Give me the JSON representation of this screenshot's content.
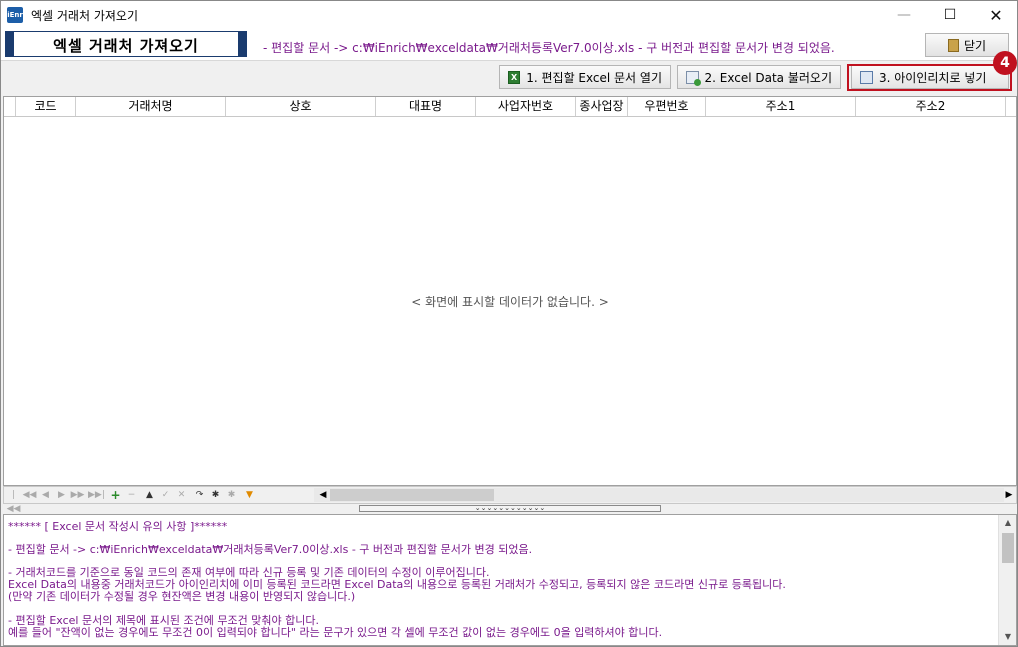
{
  "window": {
    "title": "엑셀 거래처 가져오기",
    "icon_text": "iEnr",
    "min_glyph": "—",
    "max_glyph": "☐",
    "close_glyph": "✕"
  },
  "header": {
    "main_title": "엑셀 거래처 가져오기",
    "path_note": "- 편집할 문서 -> c:₩iEnrich₩exceldata₩거래처등록Ver7.0이상.xls - 구 버전과 편집할 문서가 변경 되었음.",
    "close_label": "닫기"
  },
  "toolbar": {
    "open_excel_label": "1. 편집할 Excel 문서 열기",
    "load_data_label": "2. Excel Data 불러오기",
    "insert_label": "3. 아이인리치로 넣기",
    "step_badge": "4"
  },
  "grid": {
    "columns": [
      "코드",
      "거래처명",
      "상호",
      "대표명",
      "사업자번호",
      "종사업장",
      "우편번호",
      "주소1",
      "주소2"
    ],
    "empty_message": "< 화면에 표시할 데이터가 없습니다. >"
  },
  "navbar": {
    "first": "|◀◀",
    "prev_page": "◀◀",
    "prev": "◀",
    "next": "▶",
    "next_page": "▶▶",
    "last": "▶▶|",
    "add": "+",
    "delete": "−",
    "up": "▲",
    "confirm": "✓",
    "cancel": "✕",
    "refresh": "↷",
    "star": "✱",
    "star2": "✱",
    "filter": "▼",
    "scroll_left": "◀",
    "scroll_right": "▶"
  },
  "splitter": {
    "glyph": "⌄⌄⌄⌄⌄⌄⌄⌄⌄⌄⌄⌄"
  },
  "notes": {
    "lines": [
      "****** [ Excel 문서 작성시 유의 사항 ]******",
      "- 편집할 문서 -> c:₩iEnrich₩exceldata₩거래처등록Ver7.0이상.xls - 구 버전과 편집할 문서가 변경 되었음.",
      "- 거래처코드를 기준으로 동일 코드의 존재 여부에 따라 신규 등록 및 기존 데이터의 수정이 이루어집니다.",
      " Excel Data의 내용중 거래처코드가 아이인리치에 이미 등록된 코드라면 Excel Data의 내용으로 등록된 거래처가 수정되고, 등록되지 않은 코드라면 신규로 등록됩니다.",
      "(만약 기존 데이터가 수정될 경우 현잔액은 변경 내용이 반영되지 않습니다.)",
      "- 편집할 Excel 문서의 제목에 표시된 조건에 무조건 맞춰야 합니다.",
      "예를 들어 \"잔액이 없는 경우에도 무조건 0이 입력되야 합니다\" 라는 문구가 있으면 각 셀에 무조건 값이 없는 경우에도 0을 입력하셔야 합니다."
    ]
  },
  "colors": {
    "accent": "#1a3b6e",
    "note_text": "#7a1a8c",
    "highlight": "#c0111f"
  }
}
